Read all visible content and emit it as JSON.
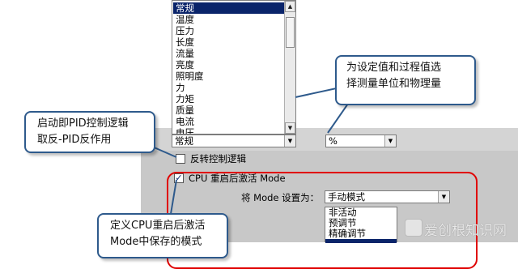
{
  "unit_list": {
    "items": [
      "常规",
      "温度",
      "压力",
      "长度",
      "流量",
      "亮度",
      "照明度",
      "力",
      "力矩",
      "质量",
      "电流",
      "电压"
    ],
    "selected_index": 0
  },
  "unit_select": {
    "value": "常规"
  },
  "percent_select": {
    "value": "%"
  },
  "invert_checkbox": {
    "label": "反转控制逻辑",
    "checked": false
  },
  "cpu_restart_checkbox": {
    "label": "CPU 重启后激活 Mode",
    "checked": true
  },
  "mode_row": {
    "label": "将 Mode 设置为：",
    "value": "手动模式"
  },
  "mode_options": [
    "非活动",
    "预调节",
    "精确调节"
  ],
  "callouts": {
    "units": [
      "为设定值和过程值选",
      "择测量单位和物理量"
    ],
    "invert": [
      "启动即PID控制逻辑",
      "取反-PID反作用"
    ],
    "cpu": [
      "定义CPU重启后激活",
      "Mode中保存的模式"
    ]
  },
  "watermark": "爱创根知识网",
  "colors": {
    "accent_blue": "#2e5a8c",
    "selection": "#0a246a",
    "highlight_red": "#e00000"
  }
}
